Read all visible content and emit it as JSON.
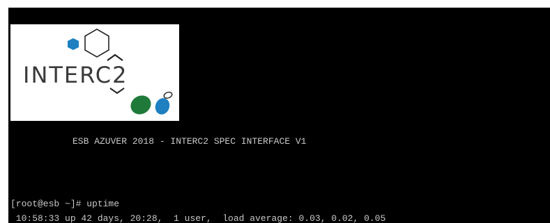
{
  "logo": {
    "wordmark": "INTERC2",
    "icon": "hexagon-molecule-logo",
    "colors": {
      "text": "#3a3a3a",
      "blue": "#1e7fc1",
      "green": "#1f7a3a",
      "outline": "#222222"
    }
  },
  "terminal": {
    "background": "#000000",
    "foreground": "#c8c8c8",
    "banner": "ESB AZUVER 2018 - INTERC2 SPEC INTERFACE V1",
    "prompt": "[root@esb ~]# ",
    "command": "uptime",
    "output": " 10:58:33 up 42 days, 20:28,  1 user,  load average: 0.03, 0.02, 0.05"
  }
}
